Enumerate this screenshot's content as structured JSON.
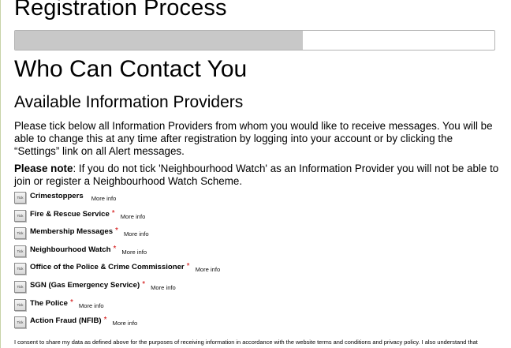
{
  "page": {
    "title": "Registration Process",
    "progress_fraction": 0.6,
    "section_title": "Who Can Contact You",
    "subsection_title": "Available Information Providers",
    "intro_text": "Please tick below all Information Providers from whom you would like to receive messages. You will be able to change this at any time after registration by logging into your account or by clicking the “Settings” link on all Alert messages.",
    "note_label": "Please note",
    "note_text": ": If you do not tick 'Neighbourhood Watch' as an Information Provider you will not be able to join or register a Neighbourhood Watch Scheme.",
    "consent_text": "I consent to share my data as defined above for the purposes of receiving information in accordance with the website terms and conditions and privacy policy. I also understand that"
  },
  "providers": [
    {
      "name": "Crimestoppers",
      "required": "",
      "tick_label": "Tick",
      "more": "More info"
    },
    {
      "name": "Fire & Rescue Service",
      "required": "*",
      "tick_label": "Tick",
      "more": "More info"
    },
    {
      "name": "Membership Messages",
      "required": "*",
      "tick_label": "Tick",
      "more": "More info"
    },
    {
      "name": "Neighbourhood Watch",
      "required": "*",
      "tick_label": "Tick",
      "more": "More info"
    },
    {
      "name": "Office of the Police & Crime Commissioner",
      "required": "*",
      "tick_label": "Tick",
      "more": "More info"
    },
    {
      "name": "SGN (Gas Emergency Service)",
      "required": "*",
      "tick_label": "Tick",
      "more": "More info"
    },
    {
      "name": "The Police",
      "required": "*",
      "tick_label": "Tick",
      "more": "More info"
    },
    {
      "name": "Action Fraud (NFIB)",
      "required": "*",
      "tick_label": "Tick",
      "more": "More info"
    }
  ],
  "colors": {
    "progress_fill": "#c8c8c8",
    "required_marker": "#d00000"
  }
}
